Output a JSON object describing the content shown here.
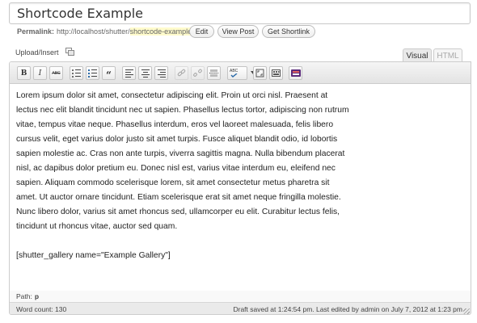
{
  "title": "Shortcode Example",
  "permalink": {
    "label": "Permalink:",
    "base": "http://localhost/shutter/",
    "slug": "shortcode-example",
    "trail": "/",
    "buttons": [
      "Edit",
      "View Post",
      "Get Shortlink"
    ]
  },
  "media": {
    "upload_label": "Upload/Insert"
  },
  "tabs": {
    "visual": "Visual",
    "html": "HTML",
    "active": "Visual"
  },
  "toolbar": {
    "bold": "B",
    "italic": "I",
    "strike": "ABC",
    "quote": "“",
    "spellcheck": "ABC"
  },
  "content": {
    "lines": [
      "Lorem ipsum dolor sit amet, consectetur adipiscing elit. Proin ut orci nisl. Praesent at",
      "lectus nec elit blandit tincidunt nec ut sapien. Phasellus lectus tortor, adipiscing non rutrum",
      "vitae, tempus vitae neque. Phasellus interdum, eros vel laoreet malesuada, felis libero",
      "cursus velit, eget varius dolor justo sit amet turpis. Fusce aliquet blandit odio, id lobortis",
      "sapien molestie ac. Cras non ante turpis, viverra sagittis magna. Nulla bibendum placerat",
      "nisl, ac dapibus dolor pretium eu. Donec nisl est, varius vitae interdum eu, eleifend nec",
      "sapien. Aliquam commodo scelerisque lorem, sit amet consectetur metus pharetra sit",
      "amet. Ut auctor ornare tincidunt. Etiam scelerisque erat sit amet neque fringilla molestie.",
      "Nunc libero dolor, varius sit amet rhoncus sed, ullamcorper eu elit. Curabitur lectus felis,",
      "tincidunt ut rhoncus vitae, auctor sed quam."
    ],
    "shortcode": "[shutter_gallery name=\"Example Gallery\"]"
  },
  "status": {
    "path_label": "Path:",
    "path_value": "p",
    "word_count_label": "Word count:",
    "word_count": "130",
    "draft_status": "Draft saved at 1:24:54 pm. Last edited by admin on July 7, 2012 at 1:23 pm"
  }
}
